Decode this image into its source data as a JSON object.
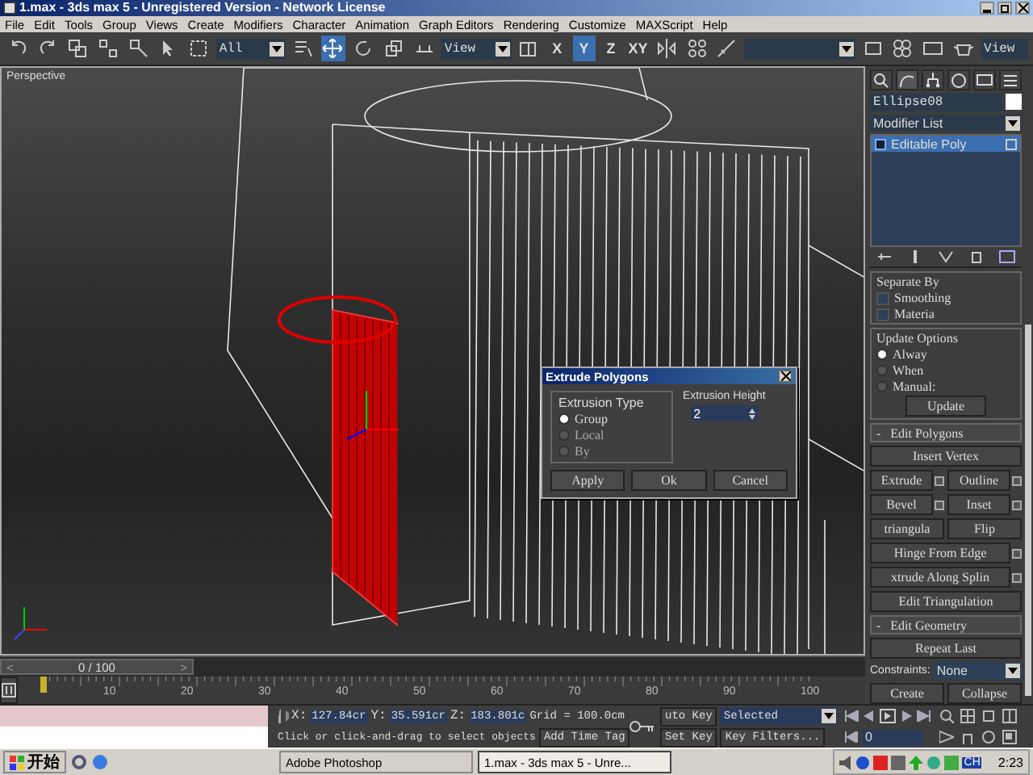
{
  "window": {
    "title": "1.max - 3ds max 5 - Unregistered Version - Network License"
  },
  "menu": [
    "File",
    "Edit",
    "Tools",
    "Group",
    "Views",
    "Create",
    "Modifiers",
    "Character",
    "Animation",
    "Graph Editors",
    "Rendering",
    "Customize",
    "MAXScript",
    "Help"
  ],
  "toolbar": {
    "selection_filter": "All",
    "transform_tools": [
      {
        "kind": "move",
        "selected": true
      },
      {
        "kind": "rotate",
        "selected": false
      },
      {
        "kind": "scale",
        "selected": false
      }
    ],
    "reference_coordinate": "View",
    "axes": [
      {
        "label": "X",
        "selected": false
      },
      {
        "label": "Y",
        "selected": true
      },
      {
        "label": "Z",
        "selected": false
      },
      {
        "label": "XY",
        "selected": false
      }
    ],
    "render_type": "View"
  },
  "viewport": {
    "label": "Perspective"
  },
  "dialog": {
    "title": "Extrude Polygons",
    "group_label": "Extrusion Type",
    "options": [
      {
        "label": "Group",
        "selected": true
      },
      {
        "label": "Local",
        "selected": false
      },
      {
        "label": "By",
        "selected": false
      }
    ],
    "height_label": "Extrusion Height",
    "height_value": "2",
    "buttons": [
      "Apply",
      "Ok",
      "Cancel"
    ]
  },
  "command_panel": {
    "object_name": "Ellipse08",
    "modifier_list": "Modifier List",
    "stack": [
      {
        "label": "Editable Poly",
        "selected": true
      }
    ],
    "separate_by": {
      "title": "Separate By",
      "options": [
        {
          "label": "Smoothing",
          "checked": false
        },
        {
          "label": "Materia",
          "checked": false
        }
      ]
    },
    "update_options": {
      "title": "Update Options",
      "options": [
        {
          "label": "Alway",
          "selected": true
        },
        {
          "label": "When",
          "selected": false
        },
        {
          "label": "Manual:",
          "selected": false
        }
      ],
      "button": "Update"
    },
    "edit_polygons": {
      "sign": "-",
      "title": "Edit Polygons",
      "rows": [
        [
          {
            "label": "Insert Vertex",
            "settings": false
          }
        ],
        [
          {
            "label": "Extrude",
            "settings": true
          },
          {
            "label": "Outline",
            "settings": true
          }
        ],
        [
          {
            "label": "Bevel",
            "settings": true
          },
          {
            "label": "Inset",
            "settings": true
          }
        ],
        [
          {
            "label": "triangula",
            "settings": false
          },
          {
            "label": "Flip",
            "settings": false
          }
        ],
        [
          {
            "label": "Hinge From Edge",
            "settings": true
          }
        ],
        [
          {
            "label": "xtrude Along Splin",
            "settings": true
          }
        ],
        [
          {
            "label": "Edit Triangulation",
            "settings": false
          }
        ]
      ]
    },
    "edit_geometry": {
      "sign": "-",
      "title": "Edit Geometry",
      "repeat": "Repeat Last",
      "constraints_label": "Constraints:",
      "constraints_value": "None",
      "buttons": [
        "Create",
        "Collapse"
      ]
    }
  },
  "time_slider": {
    "position": "0 / 100",
    "level": 0,
    "prev": "<",
    "next": ">"
  },
  "track_bar": {
    "labels": [
      "10",
      "20",
      "30",
      "40",
      "50",
      "60",
      "70",
      "80",
      "90",
      "100"
    ]
  },
  "status": {
    "x_label": "X:",
    "x": "127.84cr",
    "y_label": "Y:",
    "y": "35.591cr",
    "z_label": "Z:",
    "z": "183.801c",
    "grid": "Grid = 100.0cm",
    "prompt": "Click or click-and-drag to select objects",
    "time_tag": "Add Time Tag",
    "auto_key": "uto Key",
    "key_mode": "Selected",
    "set_key": "Set Key",
    "key_filters": "Key Filters...",
    "frame": "0"
  },
  "taskbar": {
    "start": "开始",
    "tasks": [
      {
        "label": "Adobe Photoshop",
        "selected": false
      },
      {
        "label": "1.max - 3ds max 5 - Unre...",
        "selected": true
      }
    ],
    "language": "CH",
    "clock": "2:23"
  }
}
